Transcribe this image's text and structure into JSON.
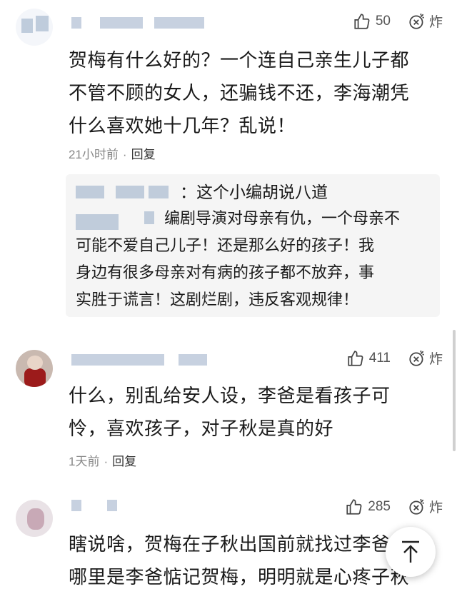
{
  "comments": [
    {
      "likes": "50",
      "bomb_label": "炸",
      "lines": [
        "贺梅有什么好的？一个连自己亲生儿子都",
        "不管不顾的女人，还骗钱不还，李海潮凭",
        "什么喜欢她十几年？乱说！"
      ],
      "time": "21小时前",
      "reply_label": "回复",
      "quote": {
        "line1": "：这个小编胡说八道",
        "body": [
          "编剧导演对母亲有仇，一个母亲不",
          "可能不爱自己儿子！还是那么好的孩子！我",
          "身边有很多母亲对有病的孩子都不放弃，事",
          "实胜于谎言！这剧烂剧，违反客观规律！"
        ]
      }
    },
    {
      "likes": "411",
      "bomb_label": "炸",
      "lines": [
        "什么，别乱给安人设，李爸是看孩子可",
        "怜，喜欢孩子，对子秋是真的好"
      ],
      "time": "1天前",
      "reply_label": "回复"
    },
    {
      "likes": "285",
      "bomb_label": "炸",
      "lines": [
        "瞎说啥，贺梅在子秋出国前就找过李爸",
        "哪里是李爸惦记贺梅，明明就是心疼子秋"
      ]
    }
  ],
  "icons": {
    "like": "thumbs-up-icon",
    "bomb": "bomb-icon",
    "scroll_top": "arrow-up-icon"
  },
  "colors": {
    "text": "#1a1a1a",
    "meta": "#888888",
    "quote_bg": "#f5f5f5"
  }
}
